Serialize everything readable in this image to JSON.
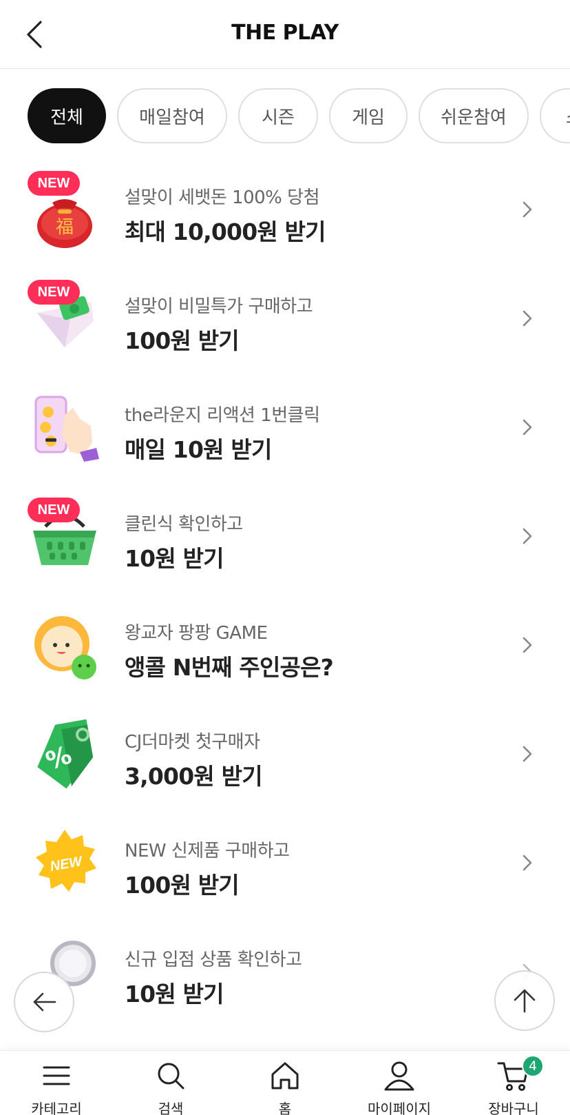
{
  "header": {
    "title": "THE PLAY",
    "back_icon": "chevron-left-icon"
  },
  "tabs": [
    {
      "label": "전체",
      "active": true
    },
    {
      "label": "매일참여",
      "active": false
    },
    {
      "label": "시즌",
      "active": false
    },
    {
      "label": "게임",
      "active": false
    },
    {
      "label": "쉬운참여",
      "active": false
    },
    {
      "label": "소",
      "active": false
    }
  ],
  "items": [
    {
      "badge": "NEW",
      "icon": "lucky-pouch-icon",
      "subtitle": "설맞이 세뱃돈 100% 당첨",
      "title": "최대 10,000원 받기"
    },
    {
      "badge": "NEW",
      "icon": "money-envelope-icon",
      "subtitle": "설맞이 비밀특가 구매하고",
      "title": "100원 받기"
    },
    {
      "badge": "",
      "icon": "phone-tap-icon",
      "subtitle": "the라운지 리액션 1번클릭",
      "title": "매일 10원 받기"
    },
    {
      "badge": "NEW",
      "icon": "shopping-basket-icon",
      "subtitle": "클린식 확인하고",
      "title": "10원 받기"
    },
    {
      "badge": "",
      "icon": "dumpling-character-icon",
      "subtitle": "왕교자 팡팡 GAME",
      "title": "앵콜 N번째 주인공은?"
    },
    {
      "badge": "",
      "icon": "discount-tag-icon",
      "subtitle": "CJ더마켓 첫구매자",
      "title": "3,000원 받기"
    },
    {
      "badge": "",
      "icon": "new-sticker-icon",
      "subtitle": "NEW 신제품 구매하고",
      "title": "100원 받기"
    },
    {
      "badge": "",
      "icon": "magnifier-icon",
      "subtitle": "신규 입점 상품 확인하고",
      "title": "10원 받기"
    }
  ],
  "floating": {
    "back_icon": "arrow-left-icon",
    "top_icon": "arrow-up-icon"
  },
  "bottom_nav": [
    {
      "label": "카테고리",
      "icon": "menu-icon"
    },
    {
      "label": "검색",
      "icon": "search-icon"
    },
    {
      "label": "홈",
      "icon": "home-icon"
    },
    {
      "label": "마이페이지",
      "icon": "user-icon"
    },
    {
      "label": "장바구니",
      "icon": "cart-icon",
      "count": "4"
    }
  ],
  "colors": {
    "accent_green": "#1ea672",
    "new_badge": "#ff2e58",
    "active_tab": "#111111"
  }
}
